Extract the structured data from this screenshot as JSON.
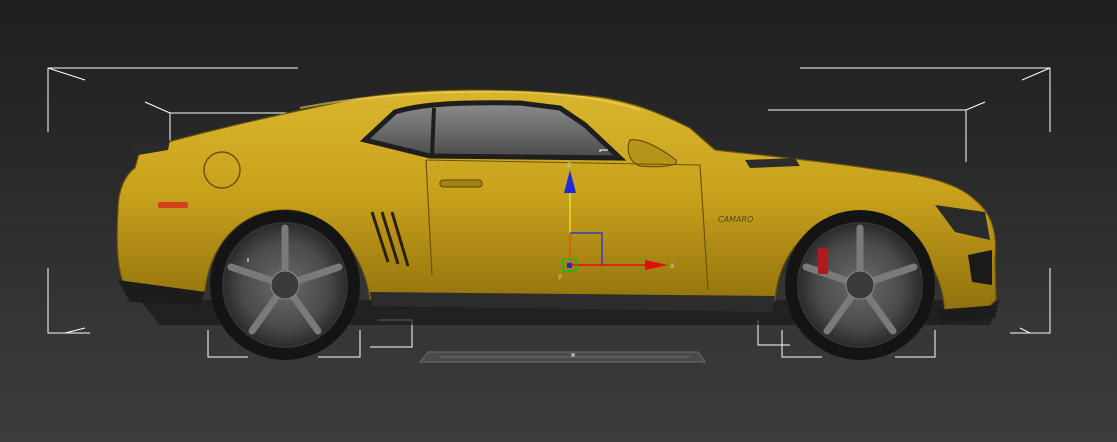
{
  "viewport": {
    "background_top": "#1f1f1f",
    "background_bottom": "#3c3c3c",
    "bbox_color": "#ffffff",
    "gizmo": {
      "axis_x_label": "x",
      "axis_y_label": "y",
      "axis_z_label": "z",
      "x_color": "#e01010",
      "y_color": "#18b818",
      "z_color": "#1a2ce0"
    }
  },
  "car": {
    "body_color": "#c9a21c",
    "badge_text": "CAMARO"
  }
}
